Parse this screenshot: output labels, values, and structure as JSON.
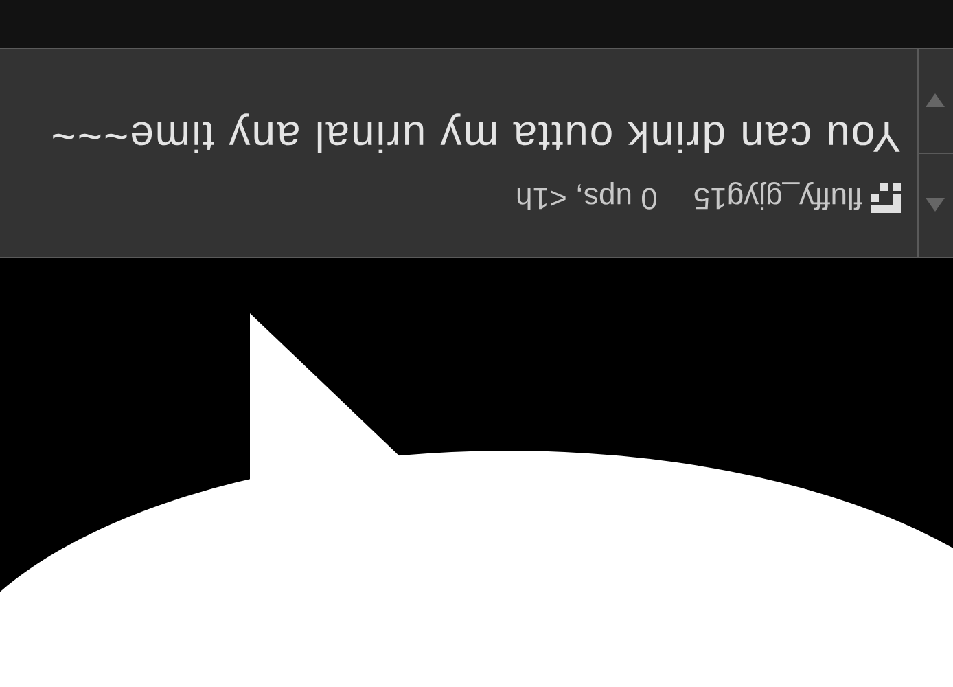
{
  "comment": {
    "username": "fluffy_gjyg15",
    "meta": "0 ups, <1h",
    "text": "You can drink outta my urinal any time~~~"
  }
}
